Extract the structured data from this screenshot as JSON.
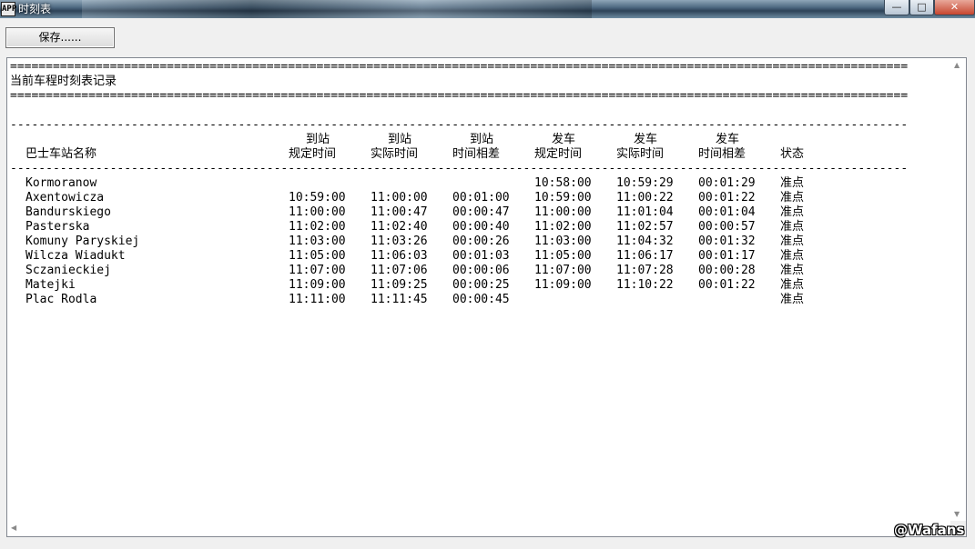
{
  "window": {
    "title": "时刻表",
    "app_icon": "APP",
    "min_glyph": "—",
    "max_glyph": "□",
    "close_glyph": "✕"
  },
  "toolbar": {
    "save_label": "保存......"
  },
  "report": {
    "separator_double": "==============================================================================================================================",
    "separator_single": "------------------------------------------------------------------------------------------------------------------------------",
    "title": "当前车程时刻表记录",
    "headers": {
      "station": "巴士车站名称",
      "arr_sched": [
        "到站",
        "规定时间"
      ],
      "arr_actual": [
        "到站",
        "实际时间"
      ],
      "arr_diff": [
        "到站",
        "时间相差"
      ],
      "dep_sched": [
        "发车",
        "规定时间"
      ],
      "dep_actual": [
        "发车",
        "实际时间"
      ],
      "dep_diff": [
        "发车",
        "时间相差"
      ],
      "status": "状态"
    },
    "rows": [
      {
        "station": "Kormoranow",
        "arr_sched": "",
        "arr_actual": "",
        "arr_diff": "",
        "dep_sched": "10:58:00",
        "dep_actual": "10:59:29",
        "dep_diff": "00:01:29",
        "status": "准点"
      },
      {
        "station": "Axentowicza",
        "arr_sched": "10:59:00",
        "arr_actual": "11:00:00",
        "arr_diff": "00:01:00",
        "dep_sched": "10:59:00",
        "dep_actual": "11:00:22",
        "dep_diff": "00:01:22",
        "status": "准点"
      },
      {
        "station": "Bandurskiego",
        "arr_sched": "11:00:00",
        "arr_actual": "11:00:47",
        "arr_diff": "00:00:47",
        "dep_sched": "11:00:00",
        "dep_actual": "11:01:04",
        "dep_diff": "00:01:04",
        "status": "准点"
      },
      {
        "station": "Pasterska",
        "arr_sched": "11:02:00",
        "arr_actual": "11:02:40",
        "arr_diff": "00:00:40",
        "dep_sched": "11:02:00",
        "dep_actual": "11:02:57",
        "dep_diff": "00:00:57",
        "status": "准点"
      },
      {
        "station": "Komuny Paryskiej",
        "arr_sched": "11:03:00",
        "arr_actual": "11:03:26",
        "arr_diff": "00:00:26",
        "dep_sched": "11:03:00",
        "dep_actual": "11:04:32",
        "dep_diff": "00:01:32",
        "status": "准点"
      },
      {
        "station": "Wilcza Wiadukt",
        "arr_sched": "11:05:00",
        "arr_actual": "11:06:03",
        "arr_diff": "00:01:03",
        "dep_sched": "11:05:00",
        "dep_actual": "11:06:17",
        "dep_diff": "00:01:17",
        "status": "准点"
      },
      {
        "station": "Sczanieckiej",
        "arr_sched": "11:07:00",
        "arr_actual": "11:07:06",
        "arr_diff": "00:00:06",
        "dep_sched": "11:07:00",
        "dep_actual": "11:07:28",
        "dep_diff": "00:00:28",
        "status": "准点"
      },
      {
        "station": "Matejki",
        "arr_sched": "11:09:00",
        "arr_actual": "11:09:25",
        "arr_diff": "00:00:25",
        "dep_sched": "11:09:00",
        "dep_actual": "11:10:22",
        "dep_diff": "00:01:22",
        "status": "准点"
      },
      {
        "station": "Plac Rodla",
        "arr_sched": "11:11:00",
        "arr_actual": "11:11:45",
        "arr_diff": "00:00:45",
        "dep_sched": "",
        "dep_actual": "",
        "dep_diff": "",
        "status": "准点"
      }
    ]
  },
  "scrollbars": {
    "up_glyph": "▲",
    "down_glyph": "▼",
    "left_glyph": "◀",
    "right_glyph": "▶"
  },
  "watermark": "@Wafans"
}
